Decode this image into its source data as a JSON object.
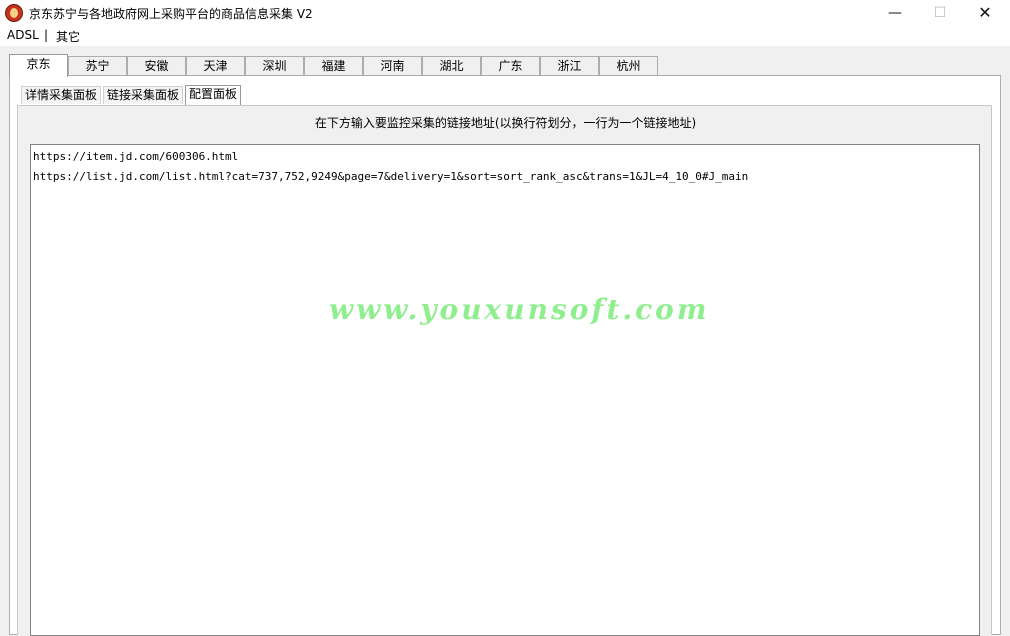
{
  "window": {
    "title": "京东苏宁与各地政府网上采购平台的商品信息采集 V2",
    "min_glyph": "—",
    "max_glyph": "☐",
    "close_glyph": "✕"
  },
  "menu": {
    "items": [
      "ADSL",
      "其它"
    ],
    "separator": "|"
  },
  "tabs": [
    "京东",
    "苏宁",
    "安徽",
    "天津",
    "深圳",
    "福建",
    "河南",
    "湖北",
    "广东",
    "浙江",
    "杭州"
  ],
  "active_tab": "京东",
  "subtabs": [
    "详情采集面板",
    "链接采集面板",
    "配置面板"
  ],
  "active_subtab": "配置面板",
  "config": {
    "hint": "在下方输入要监控采集的链接地址(以换行符划分，一行为一个链接地址)",
    "links": [
      "https://item.jd.com/600306.html",
      "https://list.jd.com/list.html?cat=737,752,9249&page=7&delivery=1&sort=sort_rank_asc&trans=1&JL=4_10_0#J_main"
    ],
    "watermark": "www.youxunsoft.com"
  }
}
